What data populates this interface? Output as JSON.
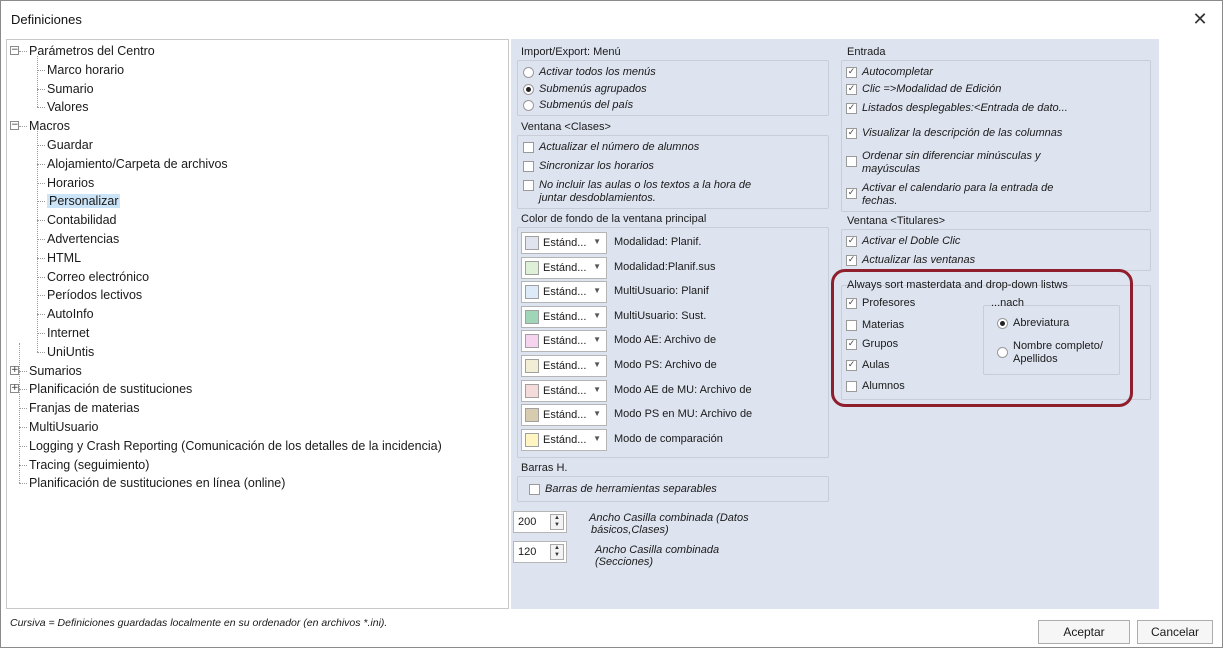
{
  "window": {
    "title": "Definiciones",
    "close_symbol": "✕"
  },
  "tree": {
    "items": [
      {
        "label": "Parámetros del Centro",
        "expander": "−"
      },
      {
        "label": "Marco horario"
      },
      {
        "label": "Sumario"
      },
      {
        "label": "Valores"
      },
      {
        "label": "Macros",
        "expander": "−"
      },
      {
        "label": "Guardar"
      },
      {
        "label": "Alojamiento/Carpeta de archivos"
      },
      {
        "label": "Horarios"
      },
      {
        "label": "Personalizar",
        "selected": true
      },
      {
        "label": "Contabilidad"
      },
      {
        "label": "Advertencias"
      },
      {
        "label": "HTML"
      },
      {
        "label": "Correo electrónico"
      },
      {
        "label": "Períodos lectivos"
      },
      {
        "label": "AutoInfo"
      },
      {
        "label": "Internet"
      },
      {
        "label": "UniUntis"
      },
      {
        "label": "Sumarios",
        "expander": "+"
      },
      {
        "label": "Planificación de sustituciones",
        "expander": "+"
      },
      {
        "label": "Franjas de materias"
      },
      {
        "label": "MultiUsuario"
      },
      {
        "label": "Logging y Crash Reporting (Comunicación de los detalles de la incidencia)"
      },
      {
        "label": "Tracing (seguimiento)"
      },
      {
        "label": "Planificación de sustituciones en línea (online)"
      }
    ]
  },
  "import_export": {
    "title": "Import/Export: Menú",
    "options": [
      {
        "label": "Activar todos los menús",
        "selected": false
      },
      {
        "label": "Submenús agrupados",
        "selected": true
      },
      {
        "label": "Submenús del país",
        "selected": false
      }
    ]
  },
  "ventana_clases": {
    "title": "Ventana <Clases>",
    "options": [
      {
        "label": "Actualizar el número de alumnos",
        "checked": false
      },
      {
        "label": "Sincronizar los horarios",
        "checked": false
      },
      {
        "label_line1": "No incluir las aulas o los textos a la hora de",
        "label_line2": "juntar desdoblamientos.",
        "checked": false
      }
    ]
  },
  "color_fondo": {
    "title": "Color de fondo de la ventana principal",
    "combo_text": "Estánd...",
    "rows": [
      {
        "label": "Modalidad: Planif.",
        "color": "#dfe4ee"
      },
      {
        "label": "Modalidad:Planif.sus",
        "color": "#dff0d8"
      },
      {
        "label": "MultiUsuario: Planif",
        "color": "#dcebf7"
      },
      {
        "label": "MultiUsuario: Sust.",
        "color": "#9fd6b8"
      },
      {
        "label": "Modo AE: Archivo de",
        "color": "#f6d3ef"
      },
      {
        "label": "Modo PS: Archivo de",
        "color": "#f2eed6"
      },
      {
        "label": "Modo AE de MU: Archivo de",
        "color": "#f5dada"
      },
      {
        "label": "Modo PS en MU: Archivo de",
        "color": "#d8ccb0"
      },
      {
        "label": "Modo de comparación",
        "color": "#fff5c2"
      }
    ]
  },
  "barras": {
    "title": "Barras H.",
    "option": {
      "label": "Barras de herramientas separables",
      "checked": false
    }
  },
  "spinners": [
    {
      "value": "200",
      "label_line1": "Ancho Casilla combinada (Datos",
      "label_line2": "básicos,Clases)"
    },
    {
      "value": "120",
      "label_line1": "Ancho Casilla combinada",
      "label_line2": "(Secciones)"
    }
  ],
  "entrada": {
    "title": "Entrada",
    "options": [
      {
        "label": "Autocompletar",
        "checked": true
      },
      {
        "label": "Clic =>Modalidad de Edición",
        "checked": true
      },
      {
        "label": "Listados desplegables:<Entrada de dato...",
        "checked": true
      },
      {
        "label": "Visualizar la descripción de las columnas",
        "checked": true
      },
      {
        "label_line1": "Ordenar sin diferenciar minúsculas y",
        "label_line2": "mayúsculas",
        "checked": false
      },
      {
        "label_line1": "Activar el calendario para la entrada de",
        "label_line2": "fechas.",
        "checked": true
      }
    ]
  },
  "ventana_titulares": {
    "title": "Ventana <Titulares>",
    "options": [
      {
        "label": "Activar el Doble Clic",
        "checked": true
      },
      {
        "label": "Actualizar las ventanas",
        "checked": true
      }
    ]
  },
  "sort_masterdata": {
    "title": "Always sort masterdata and drop-down listws",
    "options": [
      {
        "label": "Profesores",
        "checked": true
      },
      {
        "label": "Materias",
        "checked": false
      },
      {
        "label": "Grupos",
        "checked": true
      },
      {
        "label": "Aulas",
        "checked": true
      },
      {
        "label": "Alumnos",
        "checked": false
      }
    ],
    "nach": {
      "title": "...nach",
      "options": [
        {
          "label": "Abreviatura",
          "selected": true
        },
        {
          "label_line1": "Nombre completo/",
          "label_line2": "Apellidos",
          "selected": false
        }
      ]
    },
    "highlight_color": "#8f1f2c"
  },
  "footer": {
    "note": "Cursiva = Definiciones guardadas localmente en su ordenador (en archivos *.ini).",
    "accept": "Aceptar",
    "cancel": "Cancelar"
  },
  "icons": {
    "check": "✓",
    "combo_arrow": "▼",
    "spin_up": "▲",
    "spin_down": "▼"
  }
}
